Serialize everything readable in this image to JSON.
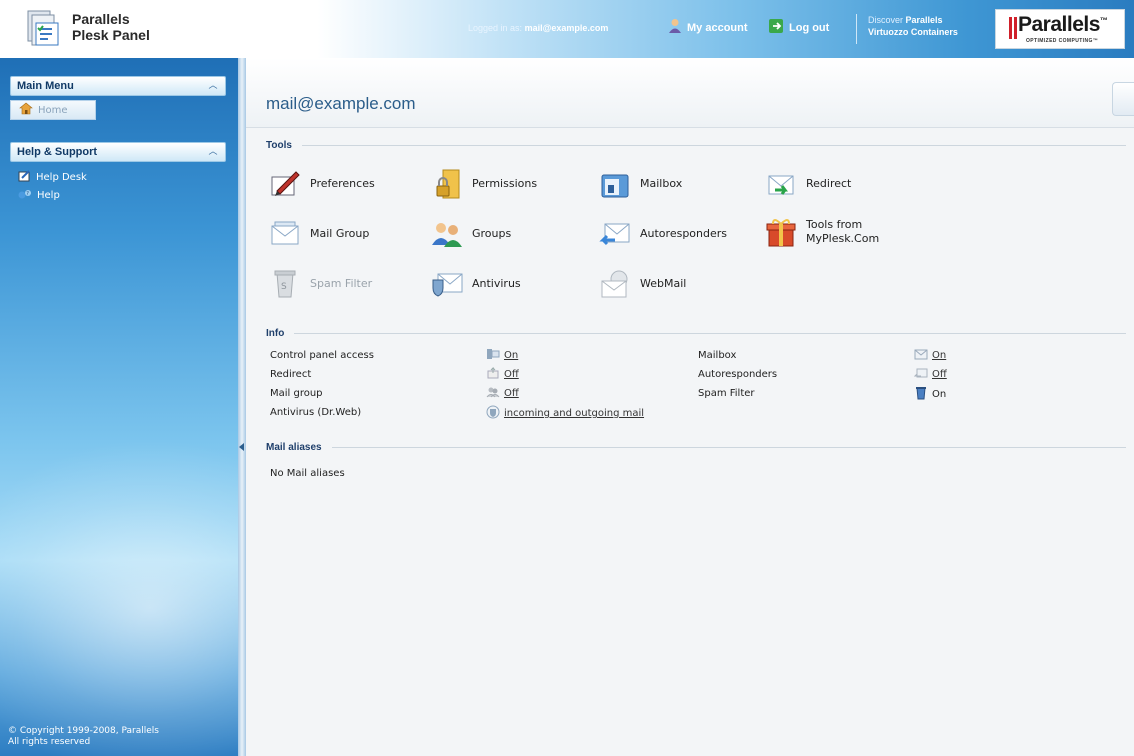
{
  "header": {
    "brand_line1": "Parallels",
    "brand_line2": "Plesk Panel",
    "logged_in_prefix": "Logged in as:",
    "logged_in_user": "mail@example.com",
    "my_account": "My account",
    "log_out": "Log out",
    "discover_prefix": "Discover",
    "discover_brand": "Parallels",
    "discover_product": "Virtuozzo Containers",
    "logo_text": "Parallels",
    "logo_tm": "™",
    "logo_sub": "OPTIMIZED COMPUTING™"
  },
  "sidebar": {
    "main_menu": {
      "title": "Main Menu",
      "items": [
        {
          "label": "Home",
          "icon": "home-icon"
        }
      ]
    },
    "help_support": {
      "title": "Help & Support",
      "items": [
        {
          "label": "Help Desk",
          "icon": "help-desk-icon"
        },
        {
          "label": "Help",
          "icon": "help-icon"
        }
      ]
    },
    "copyright_line1": "© Copyright 1999-2008, Parallels",
    "copyright_line2": "All rights reserved"
  },
  "main": {
    "title": "mail@example.com",
    "tools_title": "Tools",
    "tools": [
      {
        "label": "Preferences",
        "icon": "preferences-icon",
        "enabled": true
      },
      {
        "label": "Permissions",
        "icon": "permissions-icon",
        "enabled": true
      },
      {
        "label": "Mailbox",
        "icon": "mailbox-icon",
        "enabled": true
      },
      {
        "label": "Redirect",
        "icon": "redirect-icon",
        "enabled": true
      },
      {
        "label": "Mail Group",
        "icon": "mail-group-icon",
        "enabled": true
      },
      {
        "label": "Groups",
        "icon": "groups-icon",
        "enabled": true
      },
      {
        "label": "Autoresponders",
        "icon": "autoresponders-icon",
        "enabled": true
      },
      {
        "label": "Tools from",
        "label2": "MyPlesk.Com",
        "icon": "gift-icon",
        "enabled": true
      },
      {
        "label": "Spam Filter",
        "icon": "spam-filter-icon",
        "enabled": false
      },
      {
        "label": "Antivirus",
        "icon": "antivirus-icon",
        "enabled": true
      },
      {
        "label": "WebMail",
        "icon": "webmail-icon",
        "enabled": true
      }
    ],
    "info_title": "Info",
    "info": {
      "control_panel_access": {
        "label": "Control panel access",
        "value": "On"
      },
      "redirect": {
        "label": "Redirect",
        "value": "Off"
      },
      "mail_group": {
        "label": "Mail group",
        "value": "Off"
      },
      "antivirus": {
        "label": "Antivirus (Dr.Web)",
        "value": "incoming and outgoing mail"
      },
      "mailbox": {
        "label": "Mailbox",
        "value": "On"
      },
      "autoresponders": {
        "label": "Autoresponders",
        "value": "Off"
      },
      "spam_filter": {
        "label": "Spam Filter",
        "value": "On"
      }
    },
    "aliases_title": "Mail aliases",
    "aliases_empty": "No Mail aliases"
  }
}
